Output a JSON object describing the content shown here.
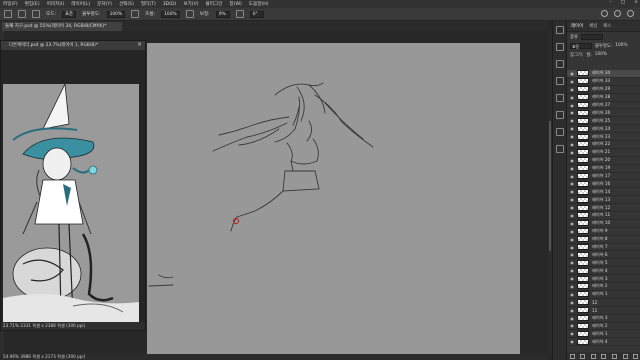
{
  "menu": [
    "파일(F)",
    "편집(E)",
    "이미지(I)",
    "레이어(L)",
    "문자(Y)",
    "선택(S)",
    "필터(T)",
    "3D(D)",
    "보기(V)",
    "플러그인",
    "창(W)",
    "도움말(H)"
  ],
  "window_controls": [
    "–",
    "□",
    "×"
  ],
  "options_bar": {
    "mode_label": "모드:",
    "mode_value": "표준",
    "opacity_label": "불투명도:",
    "opacity_value": "100%",
    "flow_label": "흐름:",
    "flow_value": "100%",
    "smooth_label": "보정:",
    "smooth_value": "0%",
    "angle_value": "0°"
  },
  "doc_tab": "둘째 지구.psd @ 55%(레이어 34, RGB/8/CMYK)*",
  "float_window": {
    "title": "다른캐릭터.psd @ 23.7%(레이어 1, RGB/8)*",
    "close": "×",
    "status": "23.71% 2331 픽셀 x 2388 픽셀 (300 ppi)"
  },
  "status_bar": "54.96% 3986 픽셀 x 2173 픽셀 (300 ppi)",
  "panel": {
    "tabs": [
      "레이어",
      "채널",
      "패스"
    ],
    "kind_label": "종류",
    "blend_value": "표준",
    "opacity_label": "불투명도:",
    "opacity_value": "100%",
    "lock_label": "잠그기:",
    "fill_label": "칠:",
    "fill_value": "100%",
    "layers": [
      "레이어 34",
      "레이어 33",
      "레이어 29",
      "레이어 28",
      "레이어 27",
      "레이어 26",
      "레이어 25",
      "레이어 24",
      "레이어 23",
      "레이어 22",
      "레이어 21",
      "레이어 20",
      "레이어 19",
      "레이어 17",
      "레이어 16",
      "레이어 14",
      "레이어 13",
      "레이어 12",
      "레이어 11",
      "레이어 10",
      "레이어 9",
      "레이어 8",
      "레이어 7",
      "레이어 6",
      "레이어 5",
      "레이어 4",
      "레이어 3",
      "레이어 2",
      "레이어 1",
      "12",
      "11",
      "레이어 3",
      "레이어 2",
      "레이어 1",
      "레이어 4"
    ]
  }
}
